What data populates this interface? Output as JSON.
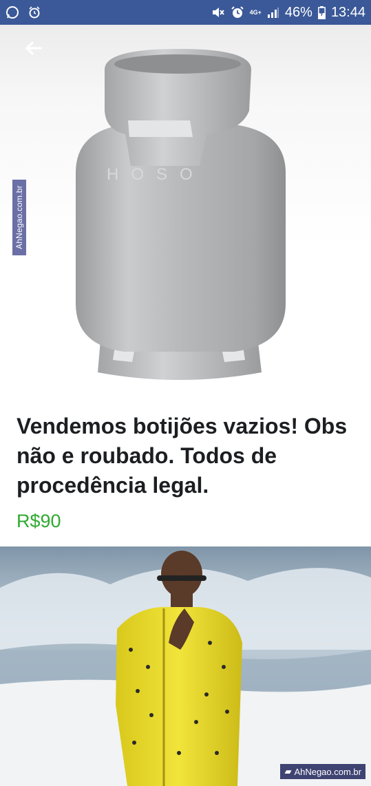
{
  "status_bar": {
    "battery": "46%",
    "time": "13:44",
    "network": "4G+",
    "icons": [
      "whatsapp-icon",
      "alarm-icon",
      "mute-icon",
      "alarm-icon",
      "signal-icon",
      "battery-icon"
    ]
  },
  "product_image": {
    "back_icon": "arrow-left-icon",
    "watermark": "AhNegao.com.br"
  },
  "listing": {
    "title": "Vendemos botijões vazios! Obs não e roubado. Todos de procedência legal.",
    "price": "R$90"
  },
  "photo": {
    "watermark": "AhNegao.com.br"
  },
  "colors": {
    "status_bar": "#3b5998",
    "price": "#2eaa2e",
    "title": "#1c1e21"
  }
}
